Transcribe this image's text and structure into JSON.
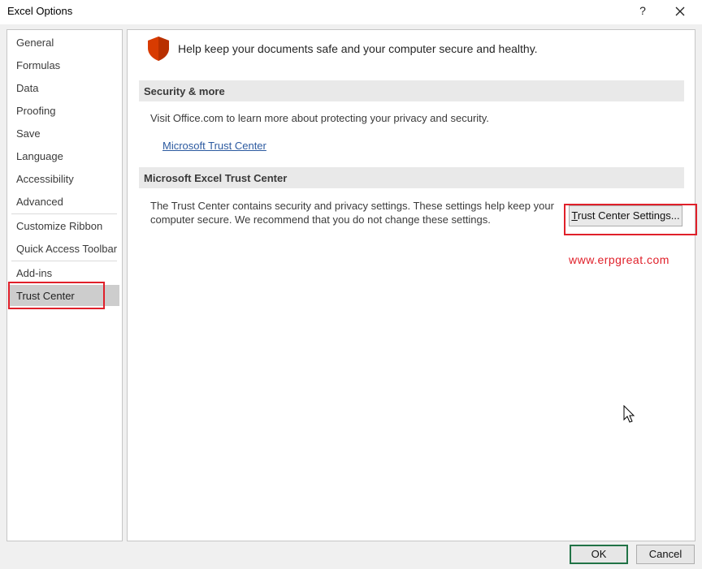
{
  "window": {
    "title": "Excel Options",
    "help_label": "?"
  },
  "sidebar": {
    "items": [
      {
        "label": "General"
      },
      {
        "label": "Formulas"
      },
      {
        "label": "Data"
      },
      {
        "label": "Proofing"
      },
      {
        "label": "Save"
      },
      {
        "label": "Language"
      },
      {
        "label": "Accessibility"
      },
      {
        "label": "Advanced"
      },
      {
        "label": "Customize Ribbon"
      },
      {
        "label": "Quick Access Toolbar"
      },
      {
        "label": "Add-ins"
      },
      {
        "label": "Trust Center"
      }
    ],
    "selected": "Trust Center"
  },
  "main": {
    "headline": "Help keep your documents safe and your computer secure and healthy.",
    "security_section": {
      "title": "Security & more",
      "text": "Visit Office.com to learn more about protecting your privacy and security.",
      "link": "Microsoft Trust Center"
    },
    "trust_section": {
      "title": "Microsoft Excel Trust Center",
      "text_line1": "The Trust Center contains security and privacy settings. These settings help keep your",
      "text_line2": "computer secure. We recommend that you do not change these settings.",
      "button_first": "T",
      "button_rest": "rust Center Settings..."
    },
    "watermark": "www.erpgreat.com"
  },
  "footer": {
    "ok_label": "OK",
    "cancel_label": "Cancel"
  },
  "colors": {
    "accent": "#217346",
    "highlight": "#e0202a",
    "shield": "#d83b01",
    "link": "#2c5aa0"
  },
  "icons": {
    "shield": "shield-icon",
    "close": "close-icon",
    "cursor": "mouse-pointer-icon"
  }
}
